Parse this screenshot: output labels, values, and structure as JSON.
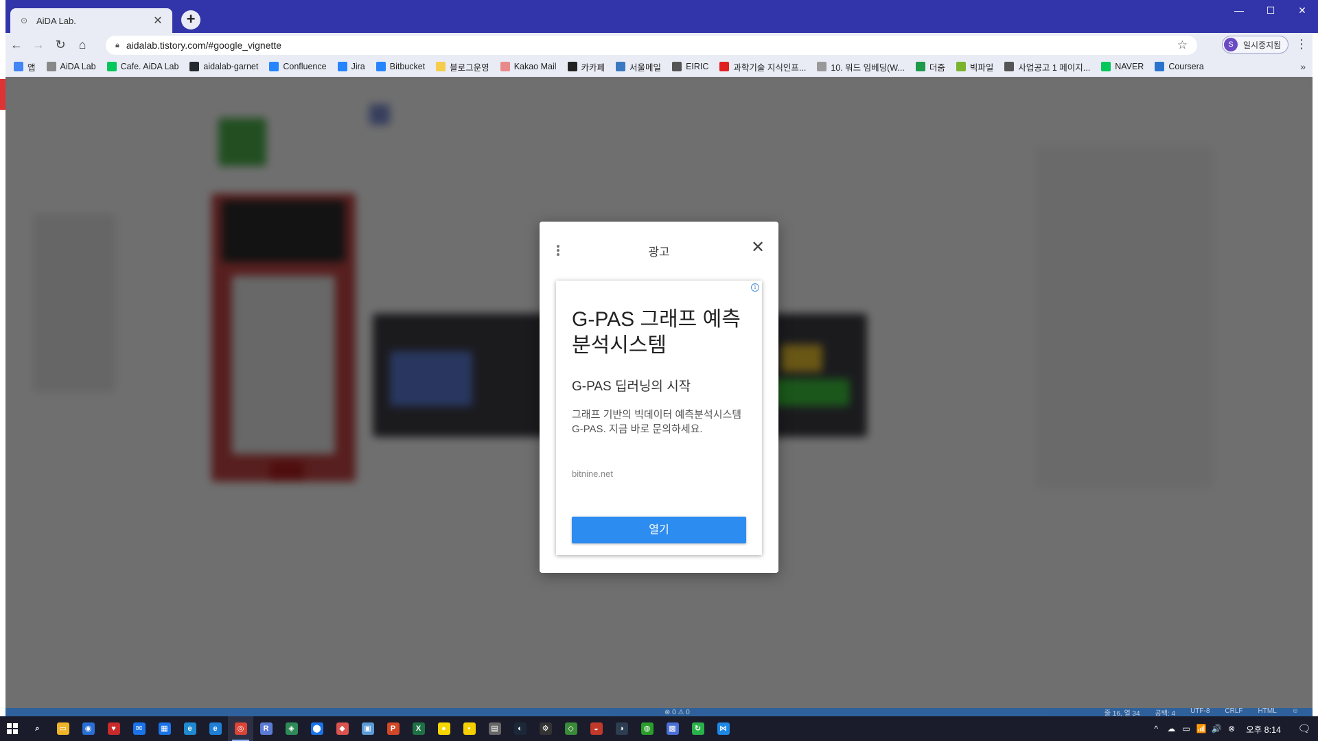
{
  "browser": {
    "tab": {
      "title": "AiDA Lab.",
      "favicon": "tistory-icon",
      "close": "✕"
    },
    "new_tab": "+",
    "window_controls": [
      "—",
      "☐",
      "✕"
    ],
    "url": "aidalab.tistory.com/#google_vignette",
    "profile": {
      "initial": "S",
      "label": "일시중지됨"
    },
    "menu": "⋮"
  },
  "bookmarks": {
    "items": [
      {
        "label": "앱",
        "icon": "apps-grid-icon",
        "color": "#4285f4"
      },
      {
        "label": "AiDA Lab",
        "icon": "tistory-icon",
        "color": "#888888"
      },
      {
        "label": "Cafe. AiDA Lab",
        "icon": "cafe-icon",
        "color": "#03c75a"
      },
      {
        "label": "aidalab-garnet",
        "icon": "github-icon",
        "color": "#24292e"
      },
      {
        "label": "Confluence",
        "icon": "confluence-icon",
        "color": "#2684ff"
      },
      {
        "label": "Jira",
        "icon": "jira-icon",
        "color": "#2684ff"
      },
      {
        "label": "Bitbucket",
        "icon": "bitbucket-icon",
        "color": "#2684ff"
      },
      {
        "label": "블로그운영",
        "icon": "folder-icon",
        "color": "#f6cd4b"
      },
      {
        "label": "Kakao Mail",
        "icon": "mail-icon",
        "color": "#e98a8a"
      },
      {
        "label": "카카페",
        "icon": "kakao-icon",
        "color": "#222222"
      },
      {
        "label": "서울메일",
        "icon": "mail-icon",
        "color": "#3b78c2"
      },
      {
        "label": "EIRIC",
        "icon": "globe-icon",
        "color": "#555555"
      },
      {
        "label": "과학기술 지식인프...",
        "icon": "circle-icon",
        "color": "#e02020"
      },
      {
        "label": "10. 워드 임베딩(W...",
        "icon": "document-icon",
        "color": "#999999"
      },
      {
        "label": "더줌",
        "icon": "phone-icon",
        "color": "#1d9a4a"
      },
      {
        "label": "빅파일",
        "icon": "bigfile-icon",
        "color": "#7ab32e"
      },
      {
        "label": "사업공고 1 페이지...",
        "icon": "globe-icon",
        "color": "#555555"
      },
      {
        "label": "NAVER",
        "icon": "naver-icon",
        "color": "#03c75a"
      },
      {
        "label": "Coursera",
        "icon": "coursera-icon",
        "color": "#2a73cc"
      }
    ],
    "more": "»"
  },
  "status_bar": {
    "left": "⊗ 0 ⚠ 0",
    "right": [
      "줄 16, 열 34",
      "공백: 4",
      "UTF-8",
      "CRLF",
      "HTML",
      "☺"
    ]
  },
  "ad": {
    "label": "광고",
    "close": "✕",
    "info": "i",
    "headline": "G-PAS 그래프 예측분석시스템",
    "subheadline": "G-PAS 딥러닝의 시작",
    "body": "그래프 기반의 빅데이터 예측분석시스템 G-PAS. 지금 바로 문의하세요.",
    "domain": "bitnine.net",
    "cta": "열기",
    "cta_color": "#2d8cf0"
  },
  "taskbar": {
    "apps": [
      {
        "name": "search-icon",
        "glyph": "⌕",
        "color": "transparent"
      },
      {
        "name": "file-explorer-icon",
        "glyph": "▭",
        "color": "#f0b429"
      },
      {
        "name": "app-icon-1",
        "glyph": "◉",
        "color": "#2a6fd6"
      },
      {
        "name": "app-icon-2",
        "glyph": "♥",
        "color": "#c92a2a"
      },
      {
        "name": "mail-icon",
        "glyph": "✉",
        "color": "#1a73e8"
      },
      {
        "name": "calendar-icon",
        "glyph": "▦",
        "color": "#1a73e8"
      },
      {
        "name": "edge-icon",
        "glyph": "e",
        "color": "#1f8ad2"
      },
      {
        "name": "ie-icon",
        "glyph": "e",
        "color": "#1f7fd6"
      },
      {
        "name": "chrome-icon",
        "glyph": "◎",
        "color": "#db4437",
        "active": true
      },
      {
        "name": "app-icon-3",
        "glyph": "R",
        "color": "#5b7bd5"
      },
      {
        "name": "app-icon-4",
        "glyph": "◈",
        "color": "#2e8b57"
      },
      {
        "name": "maps-icon",
        "glyph": "⬤",
        "color": "#1a73e8"
      },
      {
        "name": "app-icon-5",
        "glyph": "◆",
        "color": "#d9534f"
      },
      {
        "name": "app-icon-6",
        "glyph": "▣",
        "color": "#5b9bd5"
      },
      {
        "name": "powerpoint-icon",
        "glyph": "P",
        "color": "#d24726"
      },
      {
        "name": "excel-icon",
        "glyph": "X",
        "color": "#1e7145"
      },
      {
        "name": "kakaotalk-icon",
        "glyph": "●",
        "color": "#f7d600"
      },
      {
        "name": "sticky-notes-icon",
        "glyph": "▪",
        "color": "#f5d000"
      },
      {
        "name": "calculator-icon",
        "glyph": "▤",
        "color": "#666666"
      },
      {
        "name": "steam-icon",
        "glyph": "◐",
        "color": "#1b2838"
      },
      {
        "name": "app-icon-7",
        "glyph": "⚙",
        "color": "#333333"
      },
      {
        "name": "app-icon-8",
        "glyph": "◇",
        "color": "#3a8a3a"
      },
      {
        "name": "app-icon-9",
        "glyph": "◒",
        "color": "#c0392b"
      },
      {
        "name": "app-icon-10",
        "glyph": "◑",
        "color": "#2c3e50"
      },
      {
        "name": "app-icon-11",
        "glyph": "◍",
        "color": "#2a9d2a"
      },
      {
        "name": "app-icon-12",
        "glyph": "▩",
        "color": "#4a6fd6"
      },
      {
        "name": "refresh-app-icon",
        "glyph": "↻",
        "color": "#2ab24a"
      },
      {
        "name": "vscode-icon",
        "glyph": "⋈",
        "color": "#1e88e5"
      }
    ],
    "tray": [
      "^",
      "☁",
      "▭",
      "📶",
      "🔊",
      "⊗"
    ],
    "clock": "오후 8:14",
    "notification": "🗨"
  }
}
